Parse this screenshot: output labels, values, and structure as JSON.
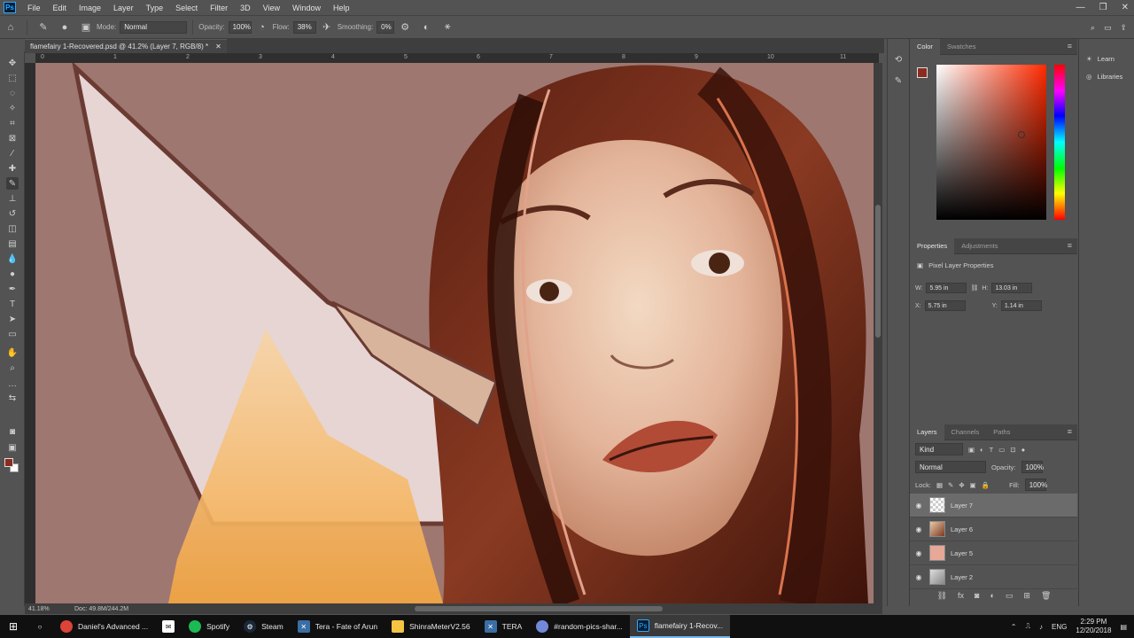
{
  "app": {
    "logo": "Ps"
  },
  "menu": [
    "File",
    "Edit",
    "Image",
    "Layer",
    "Type",
    "Select",
    "Filter",
    "3D",
    "View",
    "Window",
    "Help"
  ],
  "options": {
    "mode_label": "Mode:",
    "mode_value": "Normal",
    "opacity_label": "Opacity:",
    "opacity_value": "100%",
    "flow_label": "Flow:",
    "flow_value": "38%",
    "smoothing_label": "Smoothing:",
    "smoothing_value": "0%"
  },
  "document": {
    "tab_title": "flamefairy 1-Recovered.psd @ 41.2% (Layer 7, RGB/8) *",
    "zoom": "41.18%",
    "doc_size": "Doc: 49.8M/244.2M"
  },
  "ruler_ticks": [
    "0",
    "1",
    "2",
    "3",
    "4",
    "5",
    "6",
    "7",
    "8",
    "9",
    "10",
    "11",
    "12"
  ],
  "color_panel": {
    "tabs": [
      "Color",
      "Swatches"
    ],
    "foreground": "#8b2c20",
    "background": "#ffffff"
  },
  "properties_panel": {
    "tabs": [
      "Properties",
      "Adjustments"
    ],
    "title": "Pixel Layer Properties",
    "w_label": "W:",
    "w_value": "5.95 in",
    "h_label": "H:",
    "h_value": "13.03 in",
    "x_label": "X:",
    "x_value": "5.75 in",
    "y_label": "Y:",
    "y_value": "1.14 in"
  },
  "layers_panel": {
    "tabs": [
      "Layers",
      "Channels",
      "Paths"
    ],
    "filter_kind": "Kind",
    "blend_mode": "Normal",
    "opacity_label": "Opacity:",
    "opacity_value": "100%",
    "lock_label": "Lock:",
    "fill_label": "Fill:",
    "fill_value": "100%",
    "layers": [
      {
        "name": "Layer 7",
        "selected": true
      },
      {
        "name": "Layer 6",
        "selected": false
      },
      {
        "name": "Layer 5",
        "selected": false
      },
      {
        "name": "Layer 2",
        "selected": false
      }
    ]
  },
  "right_dock": {
    "learn": "Learn",
    "libraries": "Libraries"
  },
  "taskbar": {
    "items": [
      {
        "label": "Daniel's Advanced ...",
        "icon": "chrome-icon",
        "color": "#db4437"
      },
      {
        "label": "",
        "icon": "mail-icon",
        "color": "#ffffff"
      },
      {
        "label": "Spotify",
        "icon": "spotify-icon",
        "color": "#1db954"
      },
      {
        "label": "Steam",
        "icon": "steam-icon",
        "color": "#1b2838"
      },
      {
        "label": "Tera - Fate of Arun",
        "icon": "tera-icon",
        "color": "#3a6ea5"
      },
      {
        "label": "ShinraMeterV2.56",
        "icon": "folder-icon",
        "color": "#f4c542"
      },
      {
        "label": "TERA",
        "icon": "tera-icon",
        "color": "#3a6ea5"
      },
      {
        "label": "#random-pics-shar...",
        "icon": "discord-icon",
        "color": "#7289da"
      },
      {
        "label": "flamefairy 1-Recov...",
        "icon": "photoshop-icon",
        "color": "#31a8ff"
      }
    ],
    "language": "ENG",
    "time": "2:29 PM",
    "date": "12/20/2018"
  }
}
